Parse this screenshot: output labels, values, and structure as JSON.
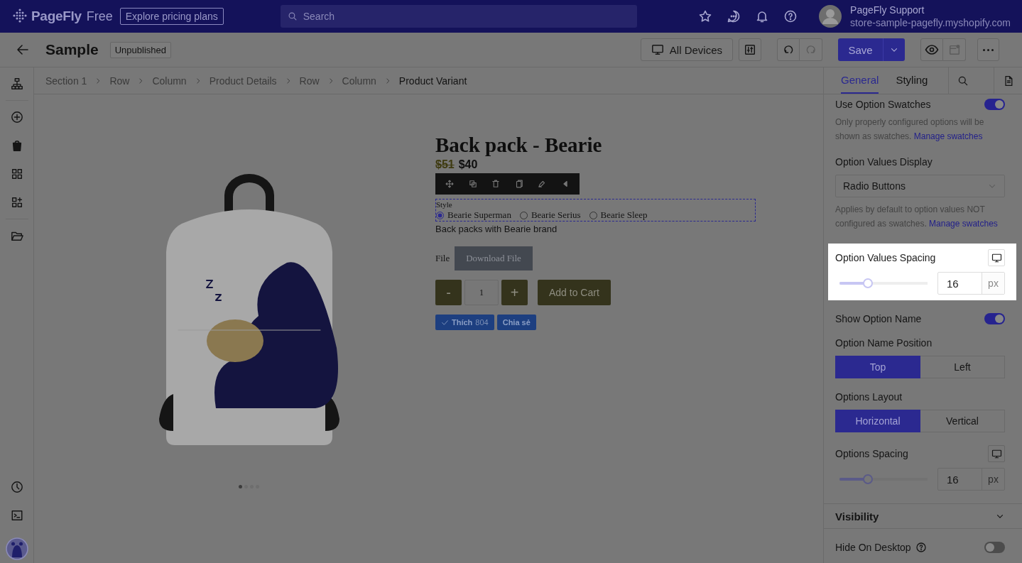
{
  "topbar": {
    "brand": "PageFly",
    "plan": "Free",
    "pricing_link": "Explore pricing plans",
    "search": {
      "placeholder": "Search"
    },
    "user": {
      "name": "PageFly Support",
      "store": "store-sample-pagefly.myshopify.com"
    }
  },
  "toolbar": {
    "title": "Sample",
    "status": "Unpublished",
    "device": "All Devices",
    "save": "Save"
  },
  "breadcrumb": [
    {
      "label": "Section 1",
      "current": false
    },
    {
      "label": "Row",
      "current": false
    },
    {
      "label": "Column",
      "current": false
    },
    {
      "label": "Product Details",
      "current": false
    },
    {
      "label": "Row",
      "current": false
    },
    {
      "label": "Column",
      "current": false
    },
    {
      "label": "Product Variant",
      "current": true
    }
  ],
  "product": {
    "title": "Back pack - Bearie",
    "old_price": "$51",
    "price": "$40",
    "image_dots": [
      {
        "selected": true
      },
      {
        "selected": false
      },
      {
        "selected": false
      },
      {
        "selected": false
      }
    ],
    "variant": {
      "label": "Style",
      "options": [
        {
          "label": "Bearie Superman",
          "selected": true
        },
        {
          "label": "Bearie Serius",
          "selected": false
        },
        {
          "label": "Bearie Sleep",
          "selected": false
        }
      ]
    },
    "description": "Back packs with Bearie brand",
    "file_label": "File",
    "download": "Download File",
    "minus": "-",
    "quantity": "1",
    "plus": "+",
    "add_to_cart": "Add to Cart",
    "like_label": "Thích",
    "like_count": "804",
    "share": "Chia sẻ"
  },
  "panel": {
    "tabs": [
      {
        "label": "General",
        "selected": true
      },
      {
        "label": "Styling",
        "selected": false
      }
    ],
    "settings": [
      {
        "kind": "toggle",
        "label": "Use Option Swatches",
        "on": true,
        "note": {
          "text": "Only properly configured options will be shown as swatches.",
          "link": "Manage swatches"
        }
      },
      {
        "kind": "select",
        "label": "Option Values Display",
        "value": "Radio Buttons",
        "note": {
          "text": "Applies by default to option values NOT configured as swatches.",
          "link": "Manage swatches"
        }
      },
      {
        "kind": "slider",
        "label": "Option Values Spacing",
        "highlighted": true,
        "level": 0.32,
        "value": "16",
        "unit": "px"
      },
      {
        "kind": "toggle",
        "label": "Show Option Name",
        "on": true
      },
      {
        "kind": "segmented",
        "label": "Option Name Position",
        "options": [
          {
            "label": "Top",
            "selected": true
          },
          {
            "label": "Left",
            "selected": false
          }
        ]
      },
      {
        "kind": "segmented",
        "label": "Options Layout",
        "options": [
          {
            "label": "Horizontal",
            "selected": true
          },
          {
            "label": "Vertical",
            "selected": false
          }
        ]
      },
      {
        "kind": "slider",
        "label": "Options Spacing",
        "highlighted": false,
        "level": 0.32,
        "value": "16",
        "unit": "px"
      },
      {
        "kind": "section",
        "label": "Visibility",
        "expanded": true
      },
      {
        "kind": "toggle",
        "label": "Hide On Desktop",
        "on": false,
        "help": true
      }
    ]
  }
}
